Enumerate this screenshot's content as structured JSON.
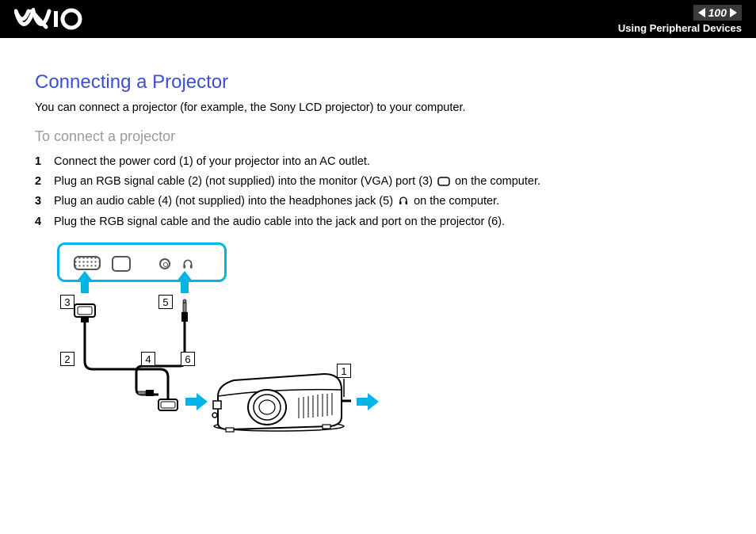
{
  "header": {
    "page_number": "100",
    "section": "Using Peripheral Devices"
  },
  "title": "Connecting a Projector",
  "intro": "You can connect a projector (for example, the Sony LCD projector) to your computer.",
  "subheading": "To connect a projector",
  "steps": {
    "s1": "Connect the power cord (1) of your projector into an AC outlet.",
    "s2a": "Plug an RGB signal cable (2) (not supplied) into the monitor (VGA) port (3) ",
    "s2b": " on the computer.",
    "s3a": "Plug an audio cable (4) (not supplied) into the headphones jack (5) ",
    "s3b": " on the computer.",
    "s4": "Plug the RGB signal cable and the audio cable into the jack and port on the projector (6)."
  },
  "callouts": {
    "c1": "1",
    "c2": "2",
    "c3": "3",
    "c4": "4",
    "c5": "5",
    "c6": "6"
  }
}
